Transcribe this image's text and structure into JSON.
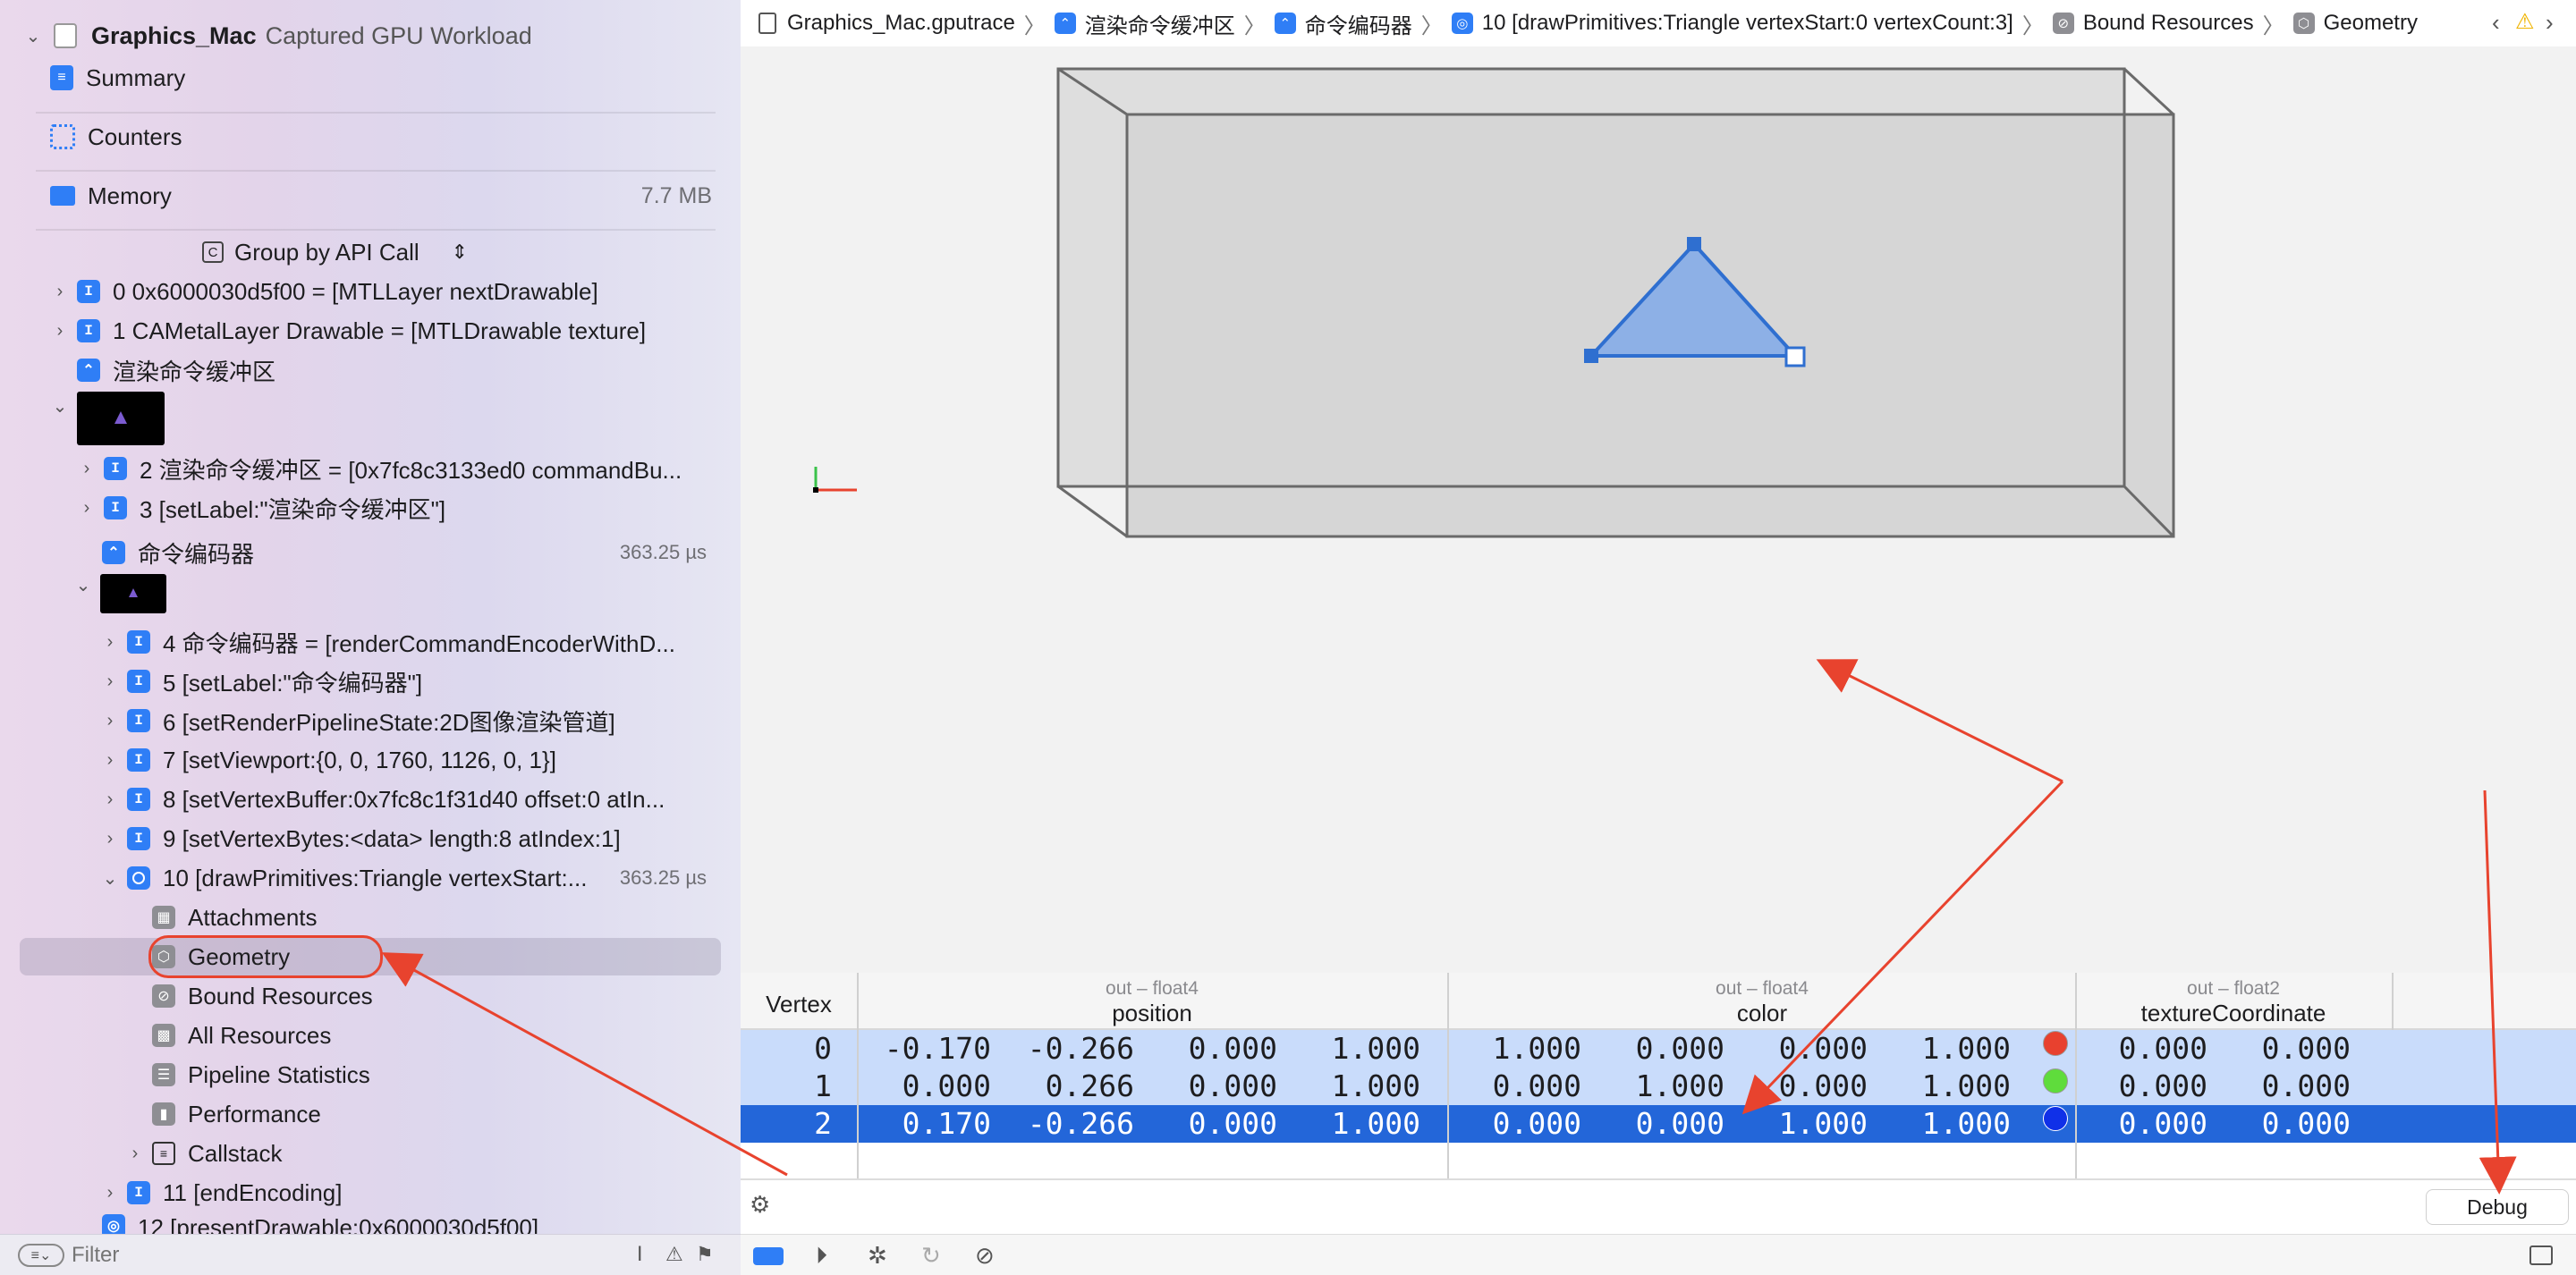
{
  "sidebar": {
    "app_title": "Graphics_Mac",
    "app_subtitle": "Captured GPU Workload",
    "summary_label": "Summary",
    "counters_label": "Counters",
    "memory_label": "Memory",
    "memory_value": "7.7 MB",
    "group_label": "Group by API Call",
    "items": [
      {
        "label": "0 0x6000030d5f00 = [MTLLayer nextDrawable]"
      },
      {
        "label": "1 CAMetalLayer Drawable = [MTLDrawable texture]"
      },
      {
        "label": "渲染命令缓冲区"
      },
      {
        "label": "2 渲染命令缓冲区 = [0x7fc8c3133ed0 commandBu..."
      },
      {
        "label": "3 [setLabel:\"渲染命令缓冲区\"]"
      },
      {
        "label": "命令编码器",
        "time": "363.25 µs"
      },
      {
        "label": "4 命令编码器 = [renderCommandEncoderWithD..."
      },
      {
        "label": "5 [setLabel:\"命令编码器\"]"
      },
      {
        "label": "6 [setRenderPipelineState:2D图像渲染管道]"
      },
      {
        "label": "7 [setViewport:{0, 0, 1760, 1126, 0, 1}]"
      },
      {
        "label": "8 [setVertexBuffer:0x7fc8c1f31d40 offset:0 atIn..."
      },
      {
        "label": "9 [setVertexBytes:<data> length:8 atIndex:1]"
      },
      {
        "label": "10 [drawPrimitives:Triangle vertexStart:...",
        "time": "363.25 µs"
      },
      {
        "label": "Attachments"
      },
      {
        "label": "Geometry"
      },
      {
        "label": "Bound Resources"
      },
      {
        "label": "All Resources"
      },
      {
        "label": "Pipeline Statistics"
      },
      {
        "label": "Performance"
      },
      {
        "label": "Callstack"
      },
      {
        "label": "11 [endEncoding]"
      },
      {
        "label": "12 [presentDrawable:0x6000030d5f00]"
      }
    ],
    "filter_placeholder": "Filter"
  },
  "breadcrumb": [
    "Graphics_Mac.gputrace",
    "渲染命令缓冲区",
    "命令编码器",
    "10 [drawPrimitives:Triangle vertexStart:0 vertexCount:3]",
    "Bound Resources",
    "Geometry"
  ],
  "table": {
    "vertex_header": "Vertex",
    "groups": [
      {
        "type": "out – float4",
        "name": "position"
      },
      {
        "type": "out – float4",
        "name": "color"
      },
      {
        "type": "out – float2",
        "name": "textureCoordinate"
      }
    ],
    "rows": [
      {
        "vertex": "0",
        "position": [
          "-0.170",
          "-0.266",
          "0.000",
          "1.000"
        ],
        "color": [
          "1.000",
          "0.000",
          "0.000",
          "1.000"
        ],
        "swatch": "#e8412f",
        "tex": [
          "0.000",
          "0.000"
        ]
      },
      {
        "vertex": "1",
        "position": [
          "0.000",
          "0.266",
          "0.000",
          "1.000"
        ],
        "color": [
          "0.000",
          "1.000",
          "0.000",
          "1.000"
        ],
        "swatch": "#5fdc3c",
        "tex": [
          "0.000",
          "0.000"
        ]
      },
      {
        "vertex": "2",
        "position": [
          "0.170",
          "-0.266",
          "0.000",
          "1.000"
        ],
        "color": [
          "0.000",
          "0.000",
          "1.000",
          "1.000"
        ],
        "swatch": "#1030e8",
        "tex": [
          "0.000",
          "0.000"
        ]
      }
    ]
  },
  "bottom": {
    "debug_label": "Debug"
  },
  "colors": {
    "accent": "#2f7ef6",
    "selection": "#2366d9",
    "annotation": "#e8432e"
  }
}
